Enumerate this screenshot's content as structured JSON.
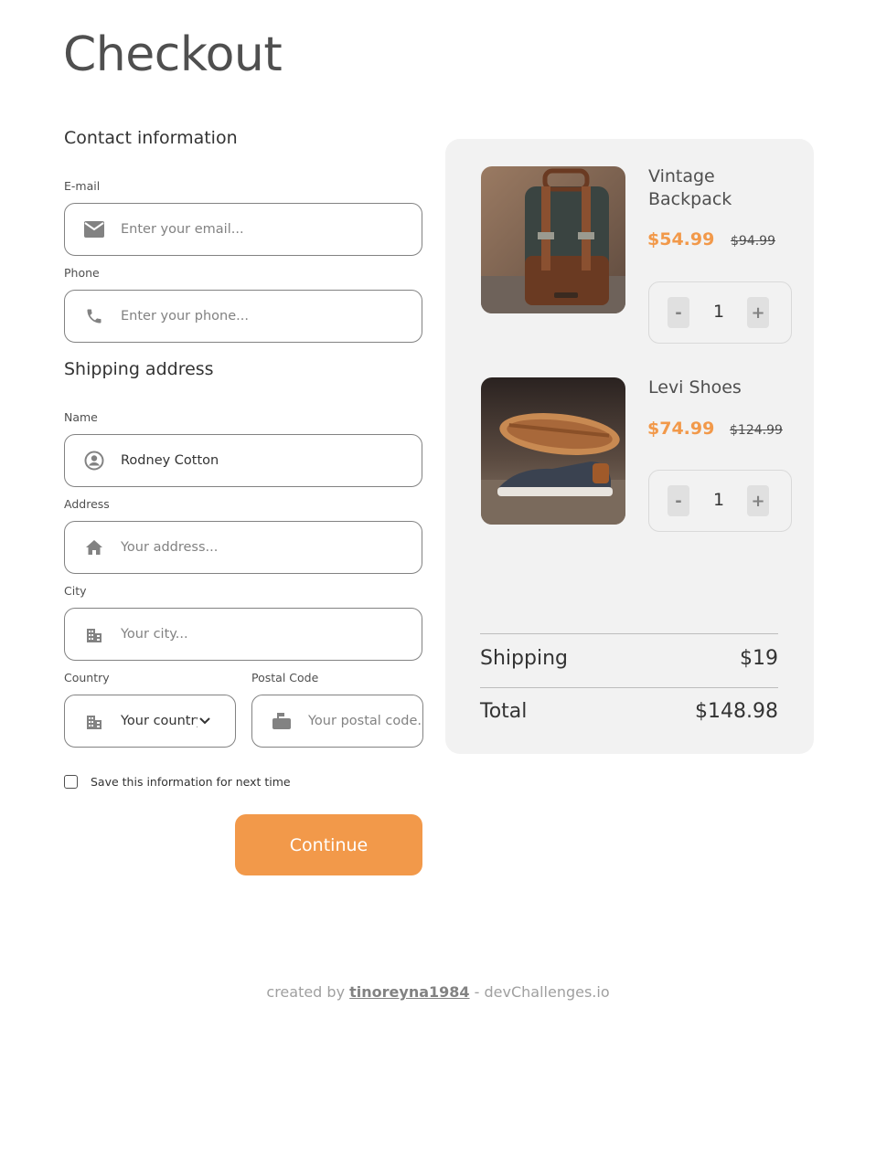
{
  "page": {
    "title": "Checkout"
  },
  "contact": {
    "title": "Contact information",
    "email_label": "E-mail",
    "email_placeholder": "Enter your email...",
    "phone_label": "Phone",
    "phone_placeholder": "Enter your phone..."
  },
  "shipping": {
    "title": "Shipping address",
    "name_label": "Name",
    "name_value": "Rodney Cotton",
    "address_label": "Address",
    "address_placeholder": "Your address...",
    "city_label": "City",
    "city_placeholder": "Your city...",
    "country_label": "Country",
    "country_value": "Your country",
    "postal_label": "Postal Code",
    "postal_placeholder": "Your postal code..."
  },
  "save_label": "Save this information for next time",
  "continue_label": "Continue",
  "cart": {
    "items": [
      {
        "name": "Vintage Backpack",
        "price": "$54.99",
        "old_price": "$94.99",
        "qty": "1"
      },
      {
        "name": "Levi Shoes",
        "price": "$74.99",
        "old_price": "$124.99",
        "qty": "1"
      }
    ],
    "minus": "-",
    "plus": "+",
    "shipping_label": "Shipping",
    "shipping_value": "$19",
    "total_label": "Total",
    "total_value": "$148.98"
  },
  "footer": {
    "prefix": "created by ",
    "author": "tinoreyna1984",
    "suffix": " - devChallenges.io"
  },
  "colors": {
    "accent": "#f2994a",
    "panel": "#f2f2f2",
    "border": "#828282"
  }
}
